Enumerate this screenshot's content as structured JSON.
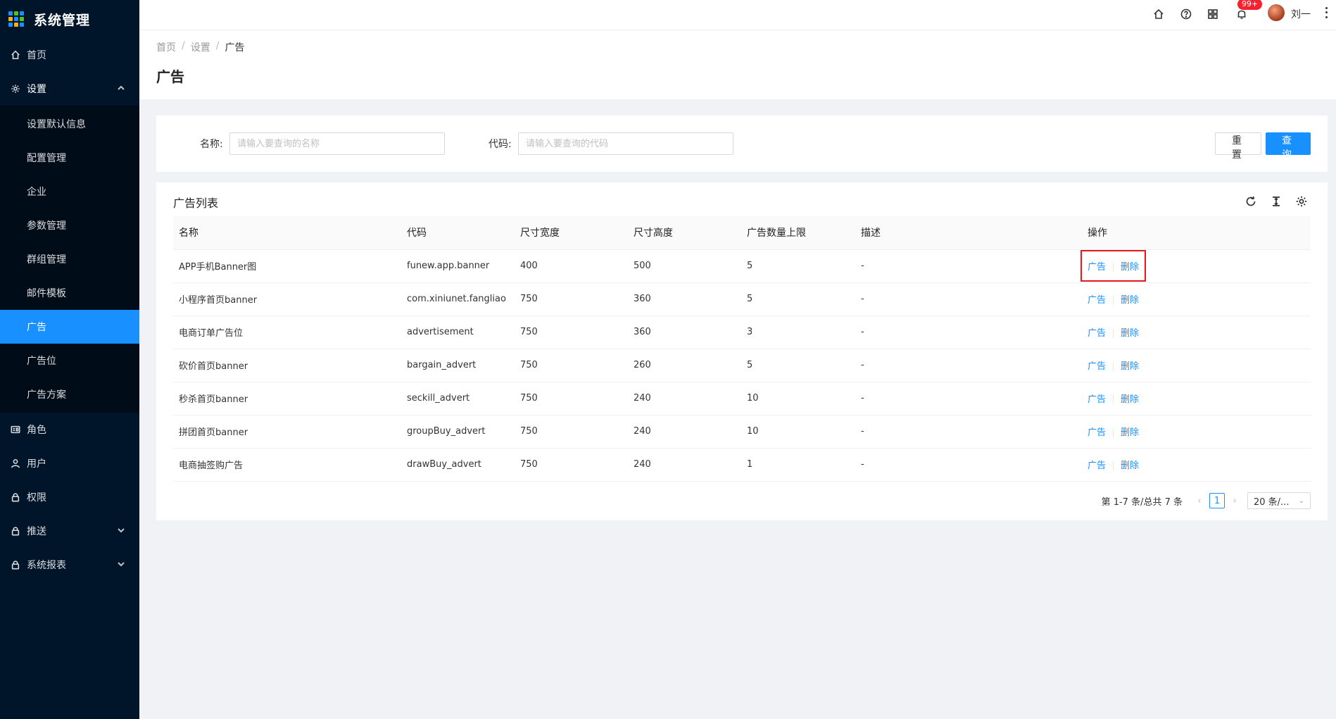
{
  "app": {
    "title": "系统管理"
  },
  "sidebar": {
    "items": [
      {
        "label": "首页",
        "icon": "home-icon"
      },
      {
        "label": "设置",
        "icon": "gear-icon",
        "open": true,
        "children": [
          {
            "label": "设置默认信息"
          },
          {
            "label": "配置管理"
          },
          {
            "label": "企业"
          },
          {
            "label": "参数管理"
          },
          {
            "label": "群组管理"
          },
          {
            "label": "邮件模板"
          },
          {
            "label": "广告",
            "active": true
          },
          {
            "label": "广告位"
          },
          {
            "label": "广告方案"
          }
        ]
      },
      {
        "label": "角色",
        "icon": "id-card-icon"
      },
      {
        "label": "用户",
        "icon": "user-icon"
      },
      {
        "label": "权限",
        "icon": "lock-icon"
      },
      {
        "label": "推送",
        "icon": "lock-icon",
        "expandable": true
      },
      {
        "label": "系统报表",
        "icon": "lock-icon",
        "expandable": true
      }
    ]
  },
  "header": {
    "notification_badge": "99+",
    "username": "刘一"
  },
  "breadcrumb": [
    "首页",
    "设置",
    "广告"
  ],
  "page": {
    "title": "广告"
  },
  "search": {
    "name_label": "名称:",
    "name_placeholder": "请输入要查询的名称",
    "code_label": "代码:",
    "code_placeholder": "请输入要查询的代码",
    "reset_label": "重置",
    "query_label": "查询"
  },
  "table": {
    "title": "广告列表",
    "columns": [
      "名称",
      "代码",
      "尺寸宽度",
      "尺寸高度",
      "广告数量上限",
      "描述",
      "操作"
    ],
    "rows": [
      [
        "APP手机Banner图",
        "funew.app.banner",
        "400",
        "500",
        "5",
        "-"
      ],
      [
        "小程序首页banner",
        "com.xiniunet.fangliao",
        "750",
        "360",
        "5",
        "-"
      ],
      [
        "电商订单广告位",
        "advertisement",
        "750",
        "360",
        "3",
        "-"
      ],
      [
        "砍价首页banner",
        "bargain_advert",
        "750",
        "260",
        "5",
        "-"
      ],
      [
        "秒杀首页banner",
        "seckill_advert",
        "750",
        "240",
        "10",
        "-"
      ],
      [
        "拼团首页banner",
        "groupBuy_advert",
        "750",
        "240",
        "10",
        "-"
      ],
      [
        "电商抽签购广告",
        "drawBuy_advert",
        "750",
        "240",
        "1",
        "-"
      ]
    ],
    "action_ad": "广告",
    "action_delete": "删除"
  },
  "pagination": {
    "total_text": "第 1-7 条/总共 7 条",
    "current_page": "1",
    "page_size": "20 条/..."
  },
  "colors": {
    "primary": "#1890ff",
    "sidebar_bg": "#001529",
    "highlight_border": "#e4181a"
  }
}
